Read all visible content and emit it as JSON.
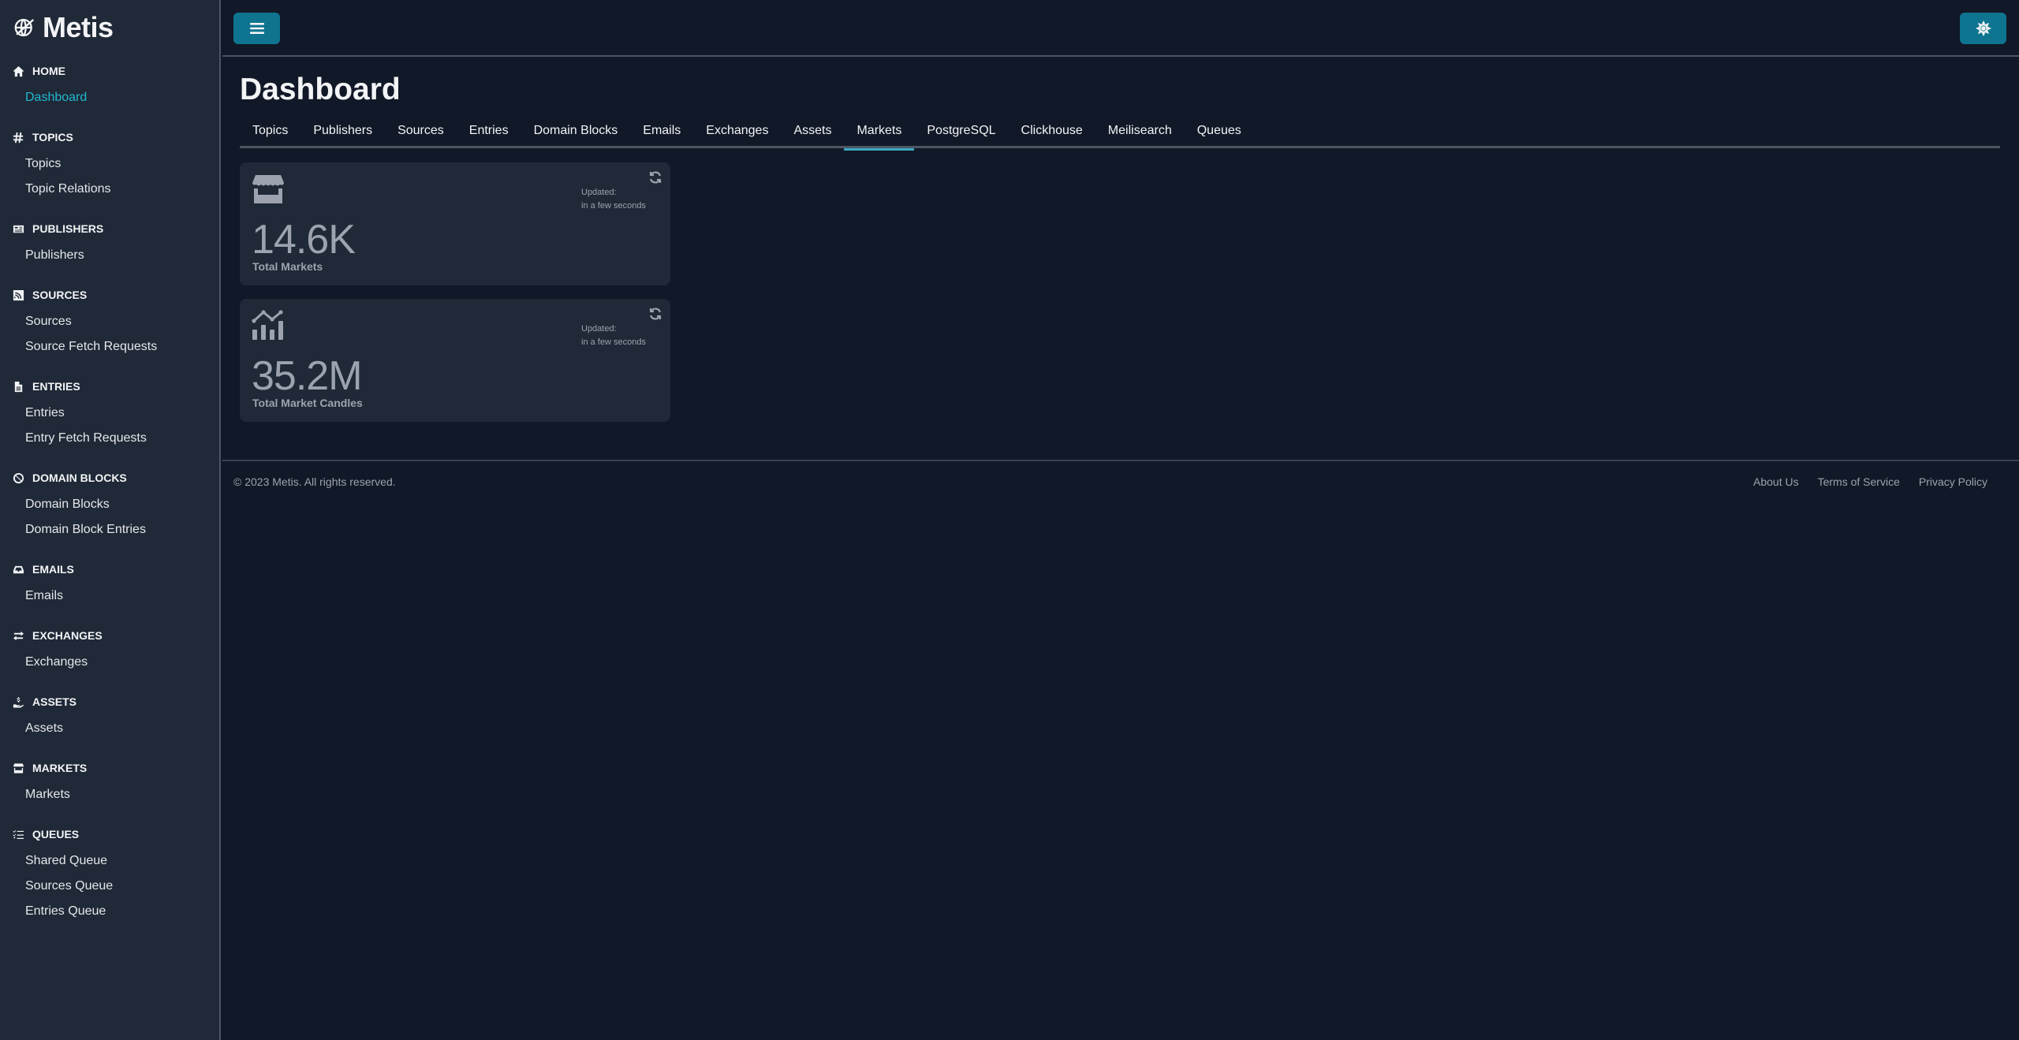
{
  "brand": {
    "name": "Metis",
    "icon": "globe-icon"
  },
  "sidebar": {
    "sections": [
      {
        "heading": "HOME",
        "icon": "home-icon",
        "items": [
          {
            "label": "Dashboard",
            "active": true
          }
        ]
      },
      {
        "heading": "TOPICS",
        "icon": "hashtag-icon",
        "items": [
          {
            "label": "Topics"
          },
          {
            "label": "Topic Relations"
          }
        ]
      },
      {
        "heading": "PUBLISHERS",
        "icon": "newspaper-icon",
        "items": [
          {
            "label": "Publishers"
          }
        ]
      },
      {
        "heading": "SOURCES",
        "icon": "rss-icon",
        "items": [
          {
            "label": "Sources"
          },
          {
            "label": "Source Fetch Requests"
          }
        ]
      },
      {
        "heading": "ENTRIES",
        "icon": "file-icon",
        "items": [
          {
            "label": "Entries"
          },
          {
            "label": "Entry Fetch Requests"
          }
        ]
      },
      {
        "heading": "DOMAIN BLOCKS",
        "icon": "ban-icon",
        "items": [
          {
            "label": "Domain Blocks"
          },
          {
            "label": "Domain Block Entries"
          }
        ]
      },
      {
        "heading": "EMAILS",
        "icon": "inbox-icon",
        "items": [
          {
            "label": "Emails"
          }
        ]
      },
      {
        "heading": "EXCHANGES",
        "icon": "exchange-icon",
        "items": [
          {
            "label": "Exchanges"
          }
        ]
      },
      {
        "heading": "ASSETS",
        "icon": "hand-dollar-icon",
        "items": [
          {
            "label": "Assets"
          }
        ]
      },
      {
        "heading": "MARKETS",
        "icon": "store-icon",
        "items": [
          {
            "label": "Markets"
          }
        ]
      },
      {
        "heading": "QUEUES",
        "icon": "list-check-icon",
        "items": [
          {
            "label": "Shared Queue"
          },
          {
            "label": "Sources Queue"
          },
          {
            "label": "Entries Queue"
          }
        ]
      }
    ]
  },
  "topbar": {
    "menu_icon": "hamburger-icon",
    "theme_icon": "sun-icon"
  },
  "main": {
    "title": "Dashboard",
    "tabs": [
      {
        "label": "Topics"
      },
      {
        "label": "Publishers"
      },
      {
        "label": "Sources"
      },
      {
        "label": "Entries"
      },
      {
        "label": "Domain Blocks"
      },
      {
        "label": "Emails"
      },
      {
        "label": "Exchanges"
      },
      {
        "label": "Assets"
      },
      {
        "label": "Markets",
        "active": true
      },
      {
        "label": "PostgreSQL"
      },
      {
        "label": "Clickhouse"
      },
      {
        "label": "Meilisearch"
      },
      {
        "label": "Queues"
      }
    ],
    "cards": [
      {
        "icon": "store-icon",
        "value": "14.6K",
        "label": "Total Markets",
        "updated_label": "Updated:",
        "updated_value": "in a few seconds"
      },
      {
        "icon": "chart-mixed-icon",
        "value": "35.2M",
        "label": "Total Market Candles",
        "updated_label": "Updated:",
        "updated_value": "in a few seconds"
      }
    ]
  },
  "footer": {
    "copyright": "© 2023 Metis. All rights reserved.",
    "links": [
      {
        "label": "About Us"
      },
      {
        "label": "Terms of Service"
      },
      {
        "label": "Privacy Policy"
      }
    ]
  },
  "colors": {
    "accent": "#0e7490",
    "active_link": "#22b8cf",
    "tab_underline": "#3ba5c2",
    "background": "#111827",
    "sidebar": "#1f2937",
    "card": "#1f2937"
  }
}
